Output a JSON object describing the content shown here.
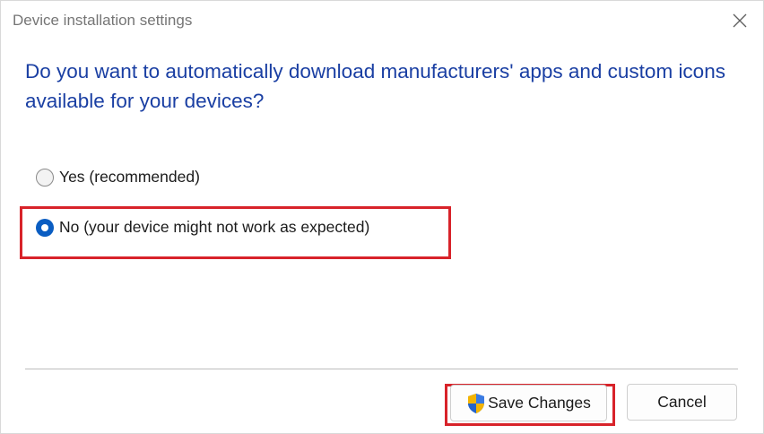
{
  "window": {
    "title": "Device installation settings"
  },
  "question": "Do you want to automatically download manufacturers' apps and custom icons available for your devices?",
  "options": [
    {
      "label": "Yes (recommended)",
      "selected": false
    },
    {
      "label": "No (your device might not work as expected)",
      "selected": true
    }
  ],
  "buttons": {
    "save_label": "Save Changes",
    "cancel_label": "Cancel"
  },
  "colors": {
    "question_text": "#1a3fa3",
    "radio_selected": "#0a5dc2",
    "highlight": "#d8232a"
  },
  "icons": {
    "close": "close-icon",
    "save": "uac-shield-icon"
  }
}
